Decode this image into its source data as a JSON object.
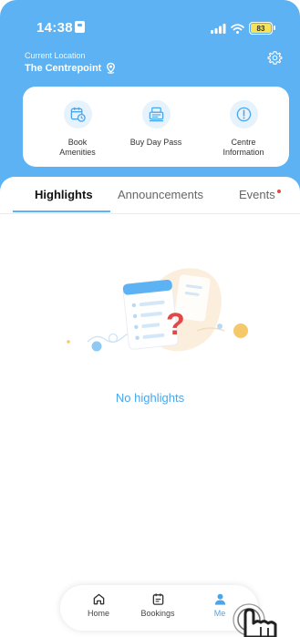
{
  "status_bar": {
    "time": "14:38",
    "battery": "83"
  },
  "location": {
    "caption": "Current Location",
    "name": "The Centrepoint"
  },
  "quick_actions": [
    {
      "label": "Book\nAmenities",
      "icon": "calendar-clock-icon"
    },
    {
      "label": "Buy Day Pass",
      "icon": "ticket-icon"
    },
    {
      "label": "Centre\nInformation",
      "icon": "info-icon"
    }
  ],
  "tabs": [
    {
      "label": "Highlights",
      "active": true
    },
    {
      "label": "Announcements",
      "active": false
    },
    {
      "label": "Events",
      "active": false,
      "badge": true
    }
  ],
  "empty_state": {
    "message": "No highlights"
  },
  "bottom_nav": [
    {
      "label": "Home",
      "icon": "home-icon"
    },
    {
      "label": "Bookings",
      "icon": "bookings-icon"
    },
    {
      "label": "Me",
      "icon": "person-icon",
      "active": true
    }
  ],
  "colors": {
    "primary": "#5cb2f2",
    "accent_red": "#e24848",
    "battery": "#f4e25a"
  }
}
